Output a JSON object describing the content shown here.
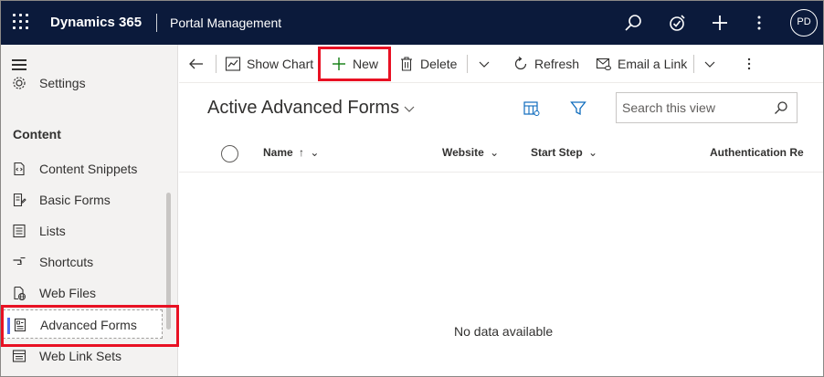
{
  "topbar": {
    "app_name": "Dynamics 365",
    "module_name": "Portal Management",
    "avatar_initials": "PD",
    "background": "#0b1a3b"
  },
  "sidebar": {
    "partial_item": {
      "label": "Settings",
      "icon": "settings-icon"
    },
    "group_header": "Content",
    "items": [
      {
        "label": "Content Snippets",
        "icon": "content-snippets-icon"
      },
      {
        "label": "Basic Forms",
        "icon": "basic-forms-icon"
      },
      {
        "label": "Lists",
        "icon": "lists-icon"
      },
      {
        "label": "Shortcuts",
        "icon": "shortcuts-icon"
      },
      {
        "label": "Web Files",
        "icon": "web-files-icon"
      },
      {
        "label": "Advanced Forms",
        "icon": "advanced-forms-icon",
        "selected": true
      },
      {
        "label": "Web Link Sets",
        "icon": "web-link-sets-icon"
      }
    ],
    "selected_accent": "#4f6bed"
  },
  "commandbar": {
    "show_chart": "Show Chart",
    "new": "New",
    "delete": "Delete",
    "refresh": "Refresh",
    "email_link": "Email a Link"
  },
  "view": {
    "title": "Active Advanced Forms",
    "search_placeholder": "Search this view",
    "columns": [
      {
        "label": "Name",
        "sort": "ascending"
      },
      {
        "label": "Website"
      },
      {
        "label": "Start Step"
      },
      {
        "label": "Authentication Re"
      }
    ],
    "empty_message": "No data available"
  },
  "highlight_color": "#e81123"
}
